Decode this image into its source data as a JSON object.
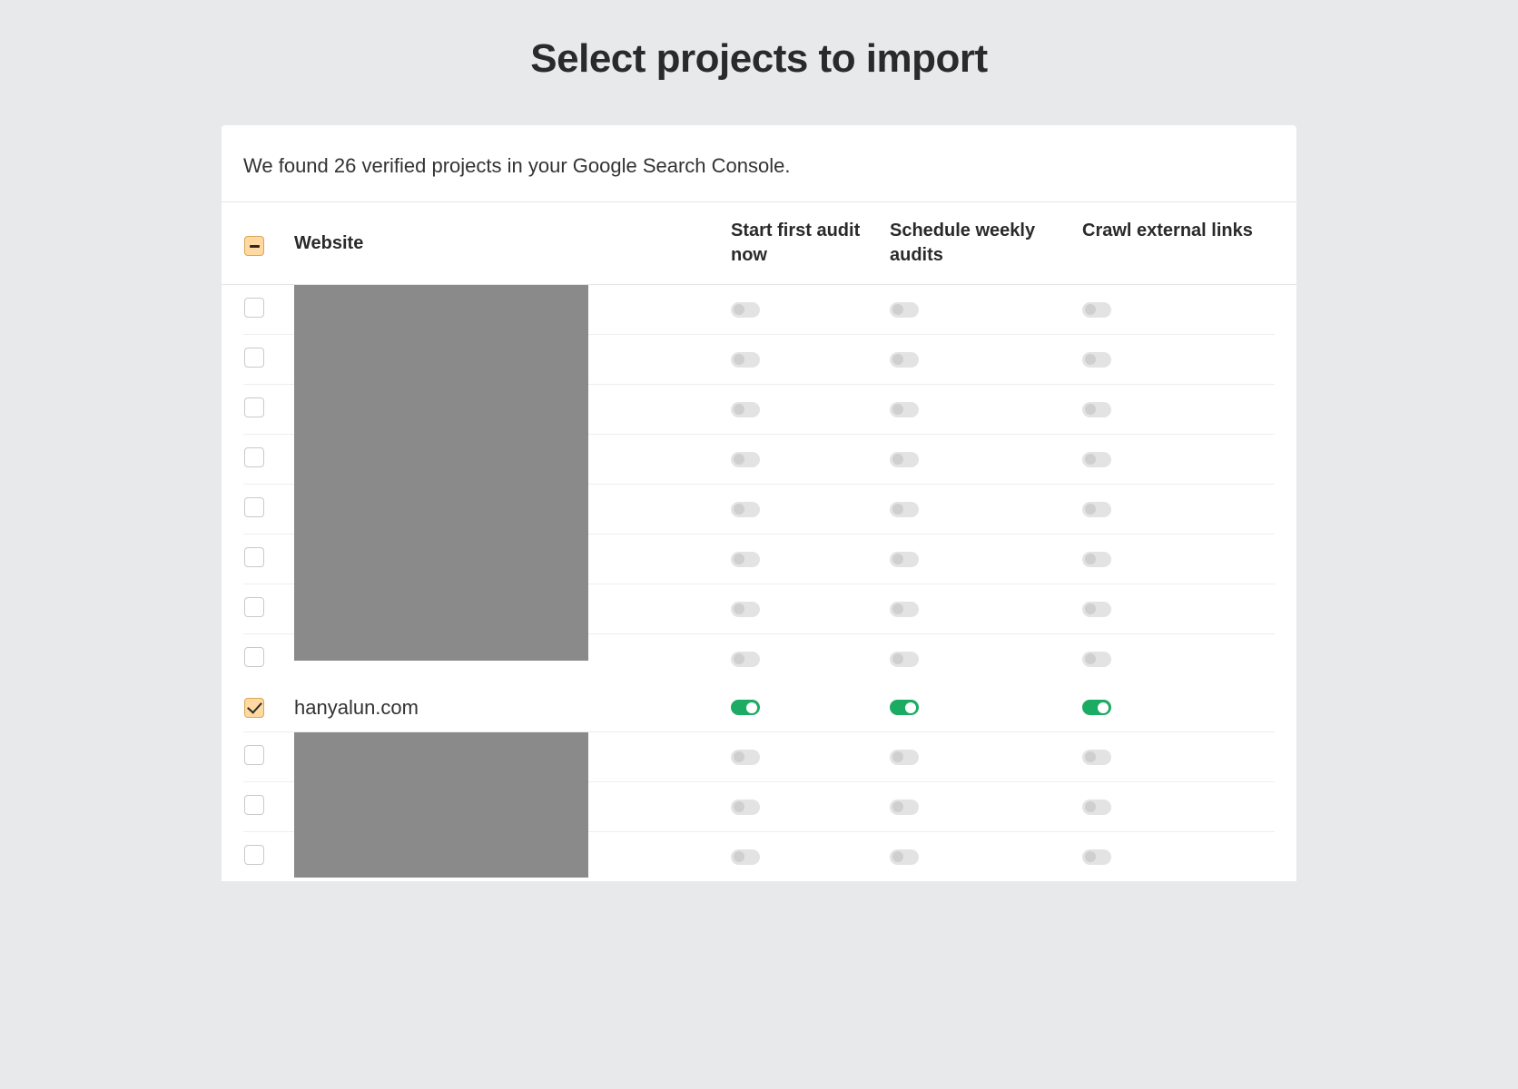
{
  "page_title": "Select projects to import",
  "summary": "We found 26 verified projects in your Google Search Console.",
  "columns": {
    "website": "Website",
    "audit_now": "Start first audit now",
    "weekly": "Schedule weekly audits",
    "external": "Crawl external links"
  },
  "select_all_state": "indeterminate",
  "rows": [
    {
      "website": "",
      "redacted": true,
      "selected": false,
      "audit_now": false,
      "weekly": false,
      "external": false
    },
    {
      "website": "",
      "redacted": true,
      "selected": false,
      "audit_now": false,
      "weekly": false,
      "external": false
    },
    {
      "website": "",
      "redacted": true,
      "selected": false,
      "audit_now": false,
      "weekly": false,
      "external": false
    },
    {
      "website": "",
      "redacted": true,
      "selected": false,
      "audit_now": false,
      "weekly": false,
      "external": false
    },
    {
      "website": "",
      "redacted": true,
      "selected": false,
      "audit_now": false,
      "weekly": false,
      "external": false
    },
    {
      "website": "",
      "redacted": true,
      "selected": false,
      "audit_now": false,
      "weekly": false,
      "external": false
    },
    {
      "website": "",
      "redacted": true,
      "selected": false,
      "audit_now": false,
      "weekly": false,
      "external": false
    },
    {
      "website": "",
      "redacted": true,
      "selected": false,
      "audit_now": false,
      "weekly": false,
      "external": false
    },
    {
      "website": "hanyalun.com",
      "redacted": false,
      "selected": true,
      "audit_now": true,
      "weekly": true,
      "external": true
    },
    {
      "website": "",
      "redacted": true,
      "selected": false,
      "audit_now": false,
      "weekly": false,
      "external": false
    },
    {
      "website": "",
      "redacted": true,
      "selected": false,
      "audit_now": false,
      "weekly": false,
      "external": false
    },
    {
      "website": "",
      "redacted": true,
      "selected": false,
      "audit_now": false,
      "weekly": false,
      "external": false
    }
  ]
}
